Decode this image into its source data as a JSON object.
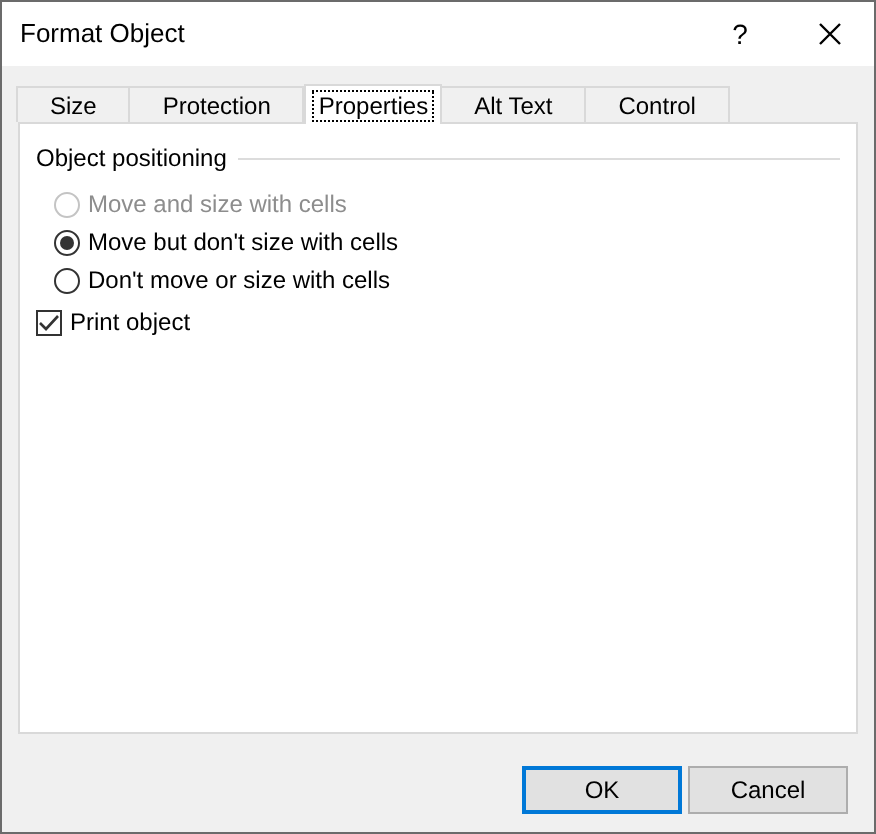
{
  "window": {
    "title": "Format Object",
    "help": "?"
  },
  "tabs": [
    {
      "label": "Size",
      "selected": false
    },
    {
      "label": "Protection",
      "selected": false
    },
    {
      "label": "Properties",
      "selected": true
    },
    {
      "label": "Alt Text",
      "selected": false
    },
    {
      "label": "Control",
      "selected": false
    }
  ],
  "group": {
    "title": "Object positioning",
    "options": [
      {
        "label": "Move and size with cells",
        "selected": false,
        "disabled": true
      },
      {
        "label": "Move but don't size with cells",
        "selected": true,
        "disabled": false
      },
      {
        "label": "Don't move or size with cells",
        "selected": false,
        "disabled": false
      }
    ]
  },
  "print_object": {
    "label": "Print object",
    "checked": true
  },
  "buttons": [
    {
      "label": "OK",
      "default": true
    },
    {
      "label": "Cancel",
      "default": false
    }
  ]
}
